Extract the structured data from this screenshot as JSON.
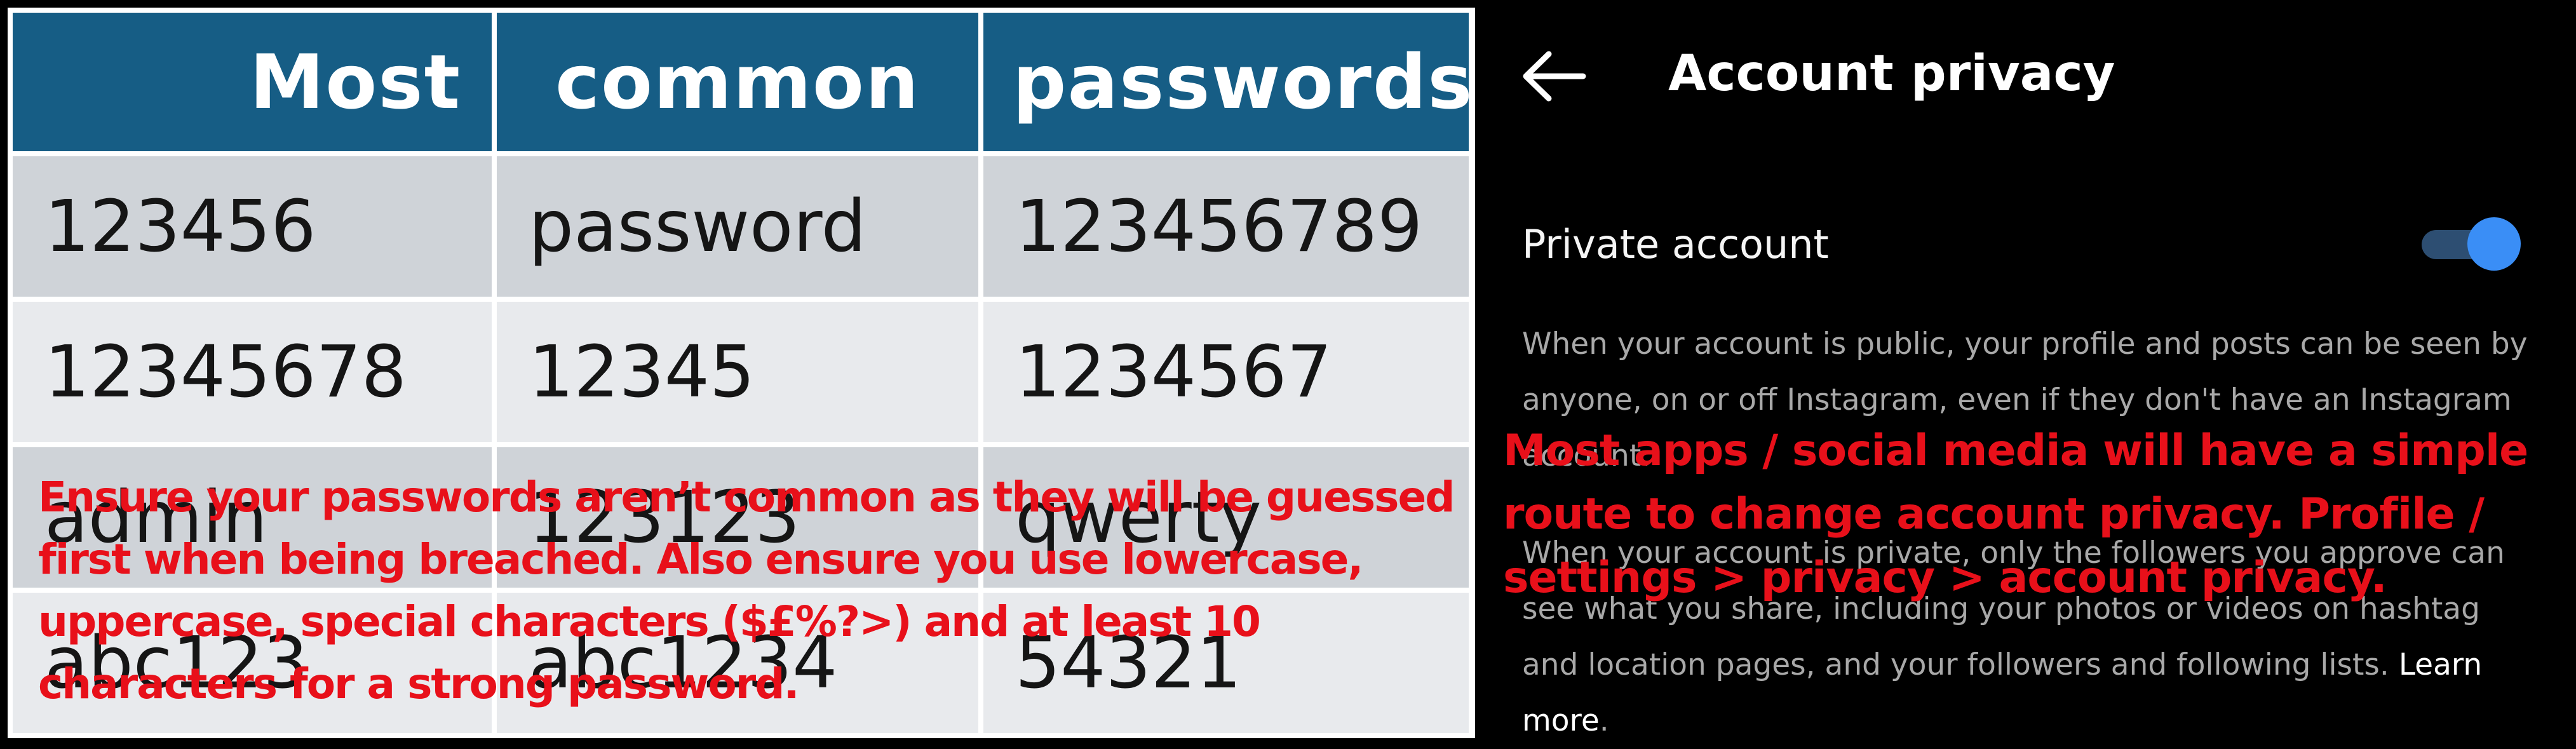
{
  "password_table": {
    "headers": [
      "Most",
      "common",
      "passwords"
    ],
    "rows": [
      [
        "123456",
        "password",
        "123456789"
      ],
      [
        "12345678",
        "12345",
        "1234567"
      ],
      [
        "admin",
        "123123",
        "qwerty"
      ],
      [
        "abc123",
        "abc1234",
        "54321"
      ]
    ]
  },
  "left_annotation": "Ensure your passwords aren’t common as they will be guessed first when being breached. Also ensure you use lowercase, uppercase, special characters ($£%?>) and at least 10 characters for a strong password.",
  "privacy_screen": {
    "title": "Account privacy",
    "back_icon": "arrow-left-icon",
    "private_account_label": "Private account",
    "private_account_enabled": true,
    "public_description": "When your account is public, your profile and posts can be seen by anyone, on or off Instagram, even if they don't have an Instagram account.",
    "private_description": "When your account is private, only the followers you approve can see what you share, including your photos or videos on hashtag and location pages, and your followers and following lists.",
    "learn_more": "Learn more",
    "learn_more_suffix": "."
  },
  "right_annotation": "Most apps / social media will have a simple route to change account privacy. Profile / settings > privacy > account privacy.",
  "colors": {
    "header_blue": "#165d85",
    "annotation_red": "#e8101a",
    "toggle_knob": "#3a8ef6",
    "toggle_track": "#2d4e72"
  }
}
